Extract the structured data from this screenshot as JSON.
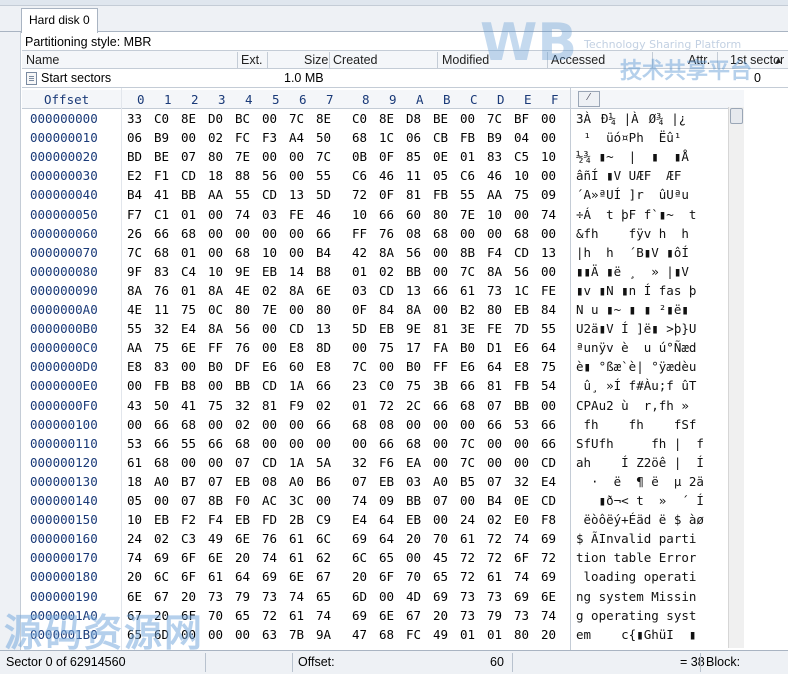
{
  "tab": {
    "label": "Hard disk 0"
  },
  "partitioning": {
    "text": "Partitioning style: MBR"
  },
  "columns": {
    "name": "Name",
    "ext": "Ext.",
    "size": "Size",
    "created": "Created",
    "modified": "Modified",
    "accessed": "Accessed",
    "attr": "Attr.",
    "first_sector": "1st sector"
  },
  "partition_row": {
    "name": "Start sectors",
    "size": "1.0 MB",
    "first_sector": "0"
  },
  "hex_header": {
    "offset": "Offset",
    "cols": [
      "0",
      "1",
      "2",
      "3",
      "4",
      "5",
      "6",
      "7",
      "8",
      "9",
      "A",
      "B",
      "C",
      "D",
      "E",
      "F"
    ]
  },
  "rows": [
    {
      "off": "000000000",
      "hex": [
        "33",
        "C0",
        "8E",
        "D0",
        "BC",
        "00",
        "7C",
        "8E",
        "C0",
        "8E",
        "D8",
        "BE",
        "00",
        "7C",
        "BF",
        "00"
      ],
      "ascii": "3ÀĐ¼ |ÀØ¾ |¿"
    },
    {
      "off": "000000010",
      "hex": [
        "06",
        "B9",
        "00",
        "02",
        "FC",
        "F3",
        "A4",
        "50",
        "68",
        "1C",
        "06",
        "CB",
        "FB",
        "B9",
        "04",
        "00"
      ],
      "ascii": " ¹  üó¤Ph  Ëû¹"
    },
    {
      "off": "000000020",
      "hex": [
        "BD",
        "BE",
        "07",
        "80",
        "7E",
        "00",
        "00",
        "7C",
        "0B",
        "0F",
        "85",
        "0E",
        "01",
        "83",
        "C5",
        "10"
      ],
      "ascii": "½¾ ▮~  |  ▮  ▮Å"
    },
    {
      "off": "000000030",
      "hex": [
        "E2",
        "F1",
        "CD",
        "18",
        "88",
        "56",
        "00",
        "55",
        "C6",
        "46",
        "11",
        "05",
        "C6",
        "46",
        "10",
        "00"
      ],
      "ascii": "âñÍ ▮V UÆF  ÆF"
    },
    {
      "off": "000000040",
      "hex": [
        "B4",
        "41",
        "BB",
        "AA",
        "55",
        "CD",
        "13",
        "5D",
        "72",
        "0F",
        "81",
        "FB",
        "55",
        "AA",
        "75",
        "09"
      ],
      "ascii": "´A»ªUÍ ]r  ûUªu"
    },
    {
      "off": "000000050",
      "hex": [
        "F7",
        "C1",
        "01",
        "00",
        "74",
        "03",
        "FE",
        "46",
        "10",
        "66",
        "60",
        "80",
        "7E",
        "10",
        "00",
        "74"
      ],
      "ascii": "÷Á  t þF f`▮~  t"
    },
    {
      "off": "000000060",
      "hex": [
        "26",
        "66",
        "68",
        "00",
        "00",
        "00",
        "00",
        "66",
        "FF",
        "76",
        "08",
        "68",
        "00",
        "00",
        "68",
        "00"
      ],
      "ascii": "&fh    fÿv h  h"
    },
    {
      "off": "000000070",
      "hex": [
        "7C",
        "68",
        "01",
        "00",
        "68",
        "10",
        "00",
        "B4",
        "42",
        "8A",
        "56",
        "00",
        "8B",
        "F4",
        "CD",
        "13"
      ],
      "ascii": "|h  h  ´B▮V ▮ôÍ"
    },
    {
      "off": "000000080",
      "hex": [
        "9F",
        "83",
        "C4",
        "10",
        "9E",
        "EB",
        "14",
        "B8",
        "01",
        "02",
        "BB",
        "00",
        "7C",
        "8A",
        "56",
        "00"
      ],
      "ascii": "▮▮Ä ▮ë ¸  » |▮V"
    },
    {
      "off": "000000090",
      "hex": [
        "8A",
        "76",
        "01",
        "8A",
        "4E",
        "02",
        "8A",
        "6E",
        "03",
        "CD",
        "13",
        "66",
        "61",
        "73",
        "1C",
        "FE"
      ],
      "ascii": "▮v ▮N ▮n Í fas þ"
    },
    {
      "off": "0000000A0",
      "hex": [
        "4E",
        "11",
        "75",
        "0C",
        "80",
        "7E",
        "00",
        "80",
        "0F",
        "84",
        "8A",
        "00",
        "B2",
        "80",
        "EB",
        "84"
      ],
      "ascii": "N u ▮~ ▮ ▮ ²▮ë▮"
    },
    {
      "off": "0000000B0",
      "hex": [
        "55",
        "32",
        "E4",
        "8A",
        "56",
        "00",
        "CD",
        "13",
        "5D",
        "EB",
        "9E",
        "81",
        "3E",
        "FE",
        "7D",
        "55"
      ],
      "ascii": "U2ä▮V Í ]ë▮ >þ}U"
    },
    {
      "off": "0000000C0",
      "hex": [
        "AA",
        "75",
        "6E",
        "FF",
        "76",
        "00",
        "E8",
        "8D",
        "00",
        "75",
        "17",
        "FA",
        "B0",
        "D1",
        "E6",
        "64"
      ],
      "ascii": "ªunÿv è  u ú°Ñæd"
    },
    {
      "off": "0000000D0",
      "hex": [
        "E8",
        "83",
        "00",
        "B0",
        "DF",
        "E6",
        "60",
        "E8",
        "7C",
        "00",
        "B0",
        "FF",
        "E6",
        "64",
        "E8",
        "75"
      ],
      "ascii": "è▮ °ßæ`è| °ÿædèu"
    },
    {
      "off": "0000000E0",
      "hex": [
        "00",
        "FB",
        "B8",
        "00",
        "BB",
        "CD",
        "1A",
        "66",
        "23",
        "C0",
        "75",
        "3B",
        "66",
        "81",
        "FB",
        "54"
      ],
      "ascii": " û¸ »Í f#Àu;f ûT"
    },
    {
      "off": "0000000F0",
      "hex": [
        "43",
        "50",
        "41",
        "75",
        "32",
        "81",
        "F9",
        "02",
        "01",
        "72",
        "2C",
        "66",
        "68",
        "07",
        "BB",
        "00"
      ],
      "ascii": "CPAu2 ù  r,fh »"
    },
    {
      "off": "000000100",
      "hex": [
        "00",
        "66",
        "68",
        "00",
        "02",
        "00",
        "00",
        "66",
        "68",
        "08",
        "00",
        "00",
        "00",
        "66",
        "53",
        "66"
      ],
      "ascii": " fh    fh    fSf"
    },
    {
      "off": "000000110",
      "hex": [
        "53",
        "66",
        "55",
        "66",
        "68",
        "00",
        "00",
        "00",
        "00",
        "66",
        "68",
        "00",
        "7C",
        "00",
        "00",
        "66"
      ],
      "ascii": "SfUfh     fh |  f"
    },
    {
      "off": "000000120",
      "hex": [
        "61",
        "68",
        "00",
        "00",
        "07",
        "CD",
        "1A",
        "5A",
        "32",
        "F6",
        "EA",
        "00",
        "7C",
        "00",
        "00",
        "CD"
      ],
      "ascii": "ah    Í Z2öê |  Í"
    },
    {
      "off": "000000130",
      "hex": [
        "18",
        "A0",
        "B7",
        "07",
        "EB",
        "08",
        "A0",
        "B6",
        "07",
        "EB",
        "03",
        "A0",
        "B5",
        "07",
        "32",
        "E4"
      ],
      "ascii": "  ·  ë  ¶ ë  µ 2ä"
    },
    {
      "off": "000000140",
      "hex": [
        "05",
        "00",
        "07",
        "8B",
        "F0",
        "AC",
        "3C",
        "00",
        "74",
        "09",
        "BB",
        "07",
        "00",
        "B4",
        "0E",
        "CD"
      ],
      "ascii": "   ▮ð¬< t  »  ´ Í"
    },
    {
      "off": "000000150",
      "hex": [
        "10",
        "EB",
        "F2",
        "F4",
        "EB",
        "FD",
        "2B",
        "C9",
        "E4",
        "64",
        "EB",
        "00",
        "24",
        "02",
        "E0",
        "F8"
      ],
      "ascii": " ëòôëý+Éäd ë $ àø"
    },
    {
      "off": "000000160",
      "hex": [
        "24",
        "02",
        "C3",
        "49",
        "6E",
        "76",
        "61",
        "6C",
        "69",
        "64",
        "20",
        "70",
        "61",
        "72",
        "74",
        "69"
      ],
      "ascii": "$ ÃInvalid parti"
    },
    {
      "off": "000000170",
      "hex": [
        "74",
        "69",
        "6F",
        "6E",
        "20",
        "74",
        "61",
        "62",
        "6C",
        "65",
        "00",
        "45",
        "72",
        "72",
        "6F",
        "72"
      ],
      "ascii": "tion table Error"
    },
    {
      "off": "000000180",
      "hex": [
        "20",
        "6C",
        "6F",
        "61",
        "64",
        "69",
        "6E",
        "67",
        "20",
        "6F",
        "70",
        "65",
        "72",
        "61",
        "74",
        "69"
      ],
      "ascii": " loading operati"
    },
    {
      "off": "000000190",
      "hex": [
        "6E",
        "67",
        "20",
        "73",
        "79",
        "73",
        "74",
        "65",
        "6D",
        "00",
        "4D",
        "69",
        "73",
        "73",
        "69",
        "6E"
      ],
      "ascii": "ng system Missin"
    },
    {
      "off": "0000001A0",
      "hex": [
        "67",
        "20",
        "6F",
        "70",
        "65",
        "72",
        "61",
        "74",
        "69",
        "6E",
        "67",
        "20",
        "73",
        "79",
        "73",
        "74"
      ],
      "ascii": "g operating syst"
    },
    {
      "off": "0000001B0",
      "hex": [
        "65",
        "6D",
        "00",
        "00",
        "00",
        "63",
        "7B",
        "9A",
        "47",
        "68",
        "FC",
        "49",
        "01",
        "01",
        "80",
        "20"
      ],
      "ascii": "em    c{▮GhüI  ▮"
    }
  ],
  "status": {
    "sector": "Sector 0 of 62914560",
    "offset_label": "Offset:",
    "offset_value": "60",
    "eq": "= 38",
    "block": "Block:"
  }
}
